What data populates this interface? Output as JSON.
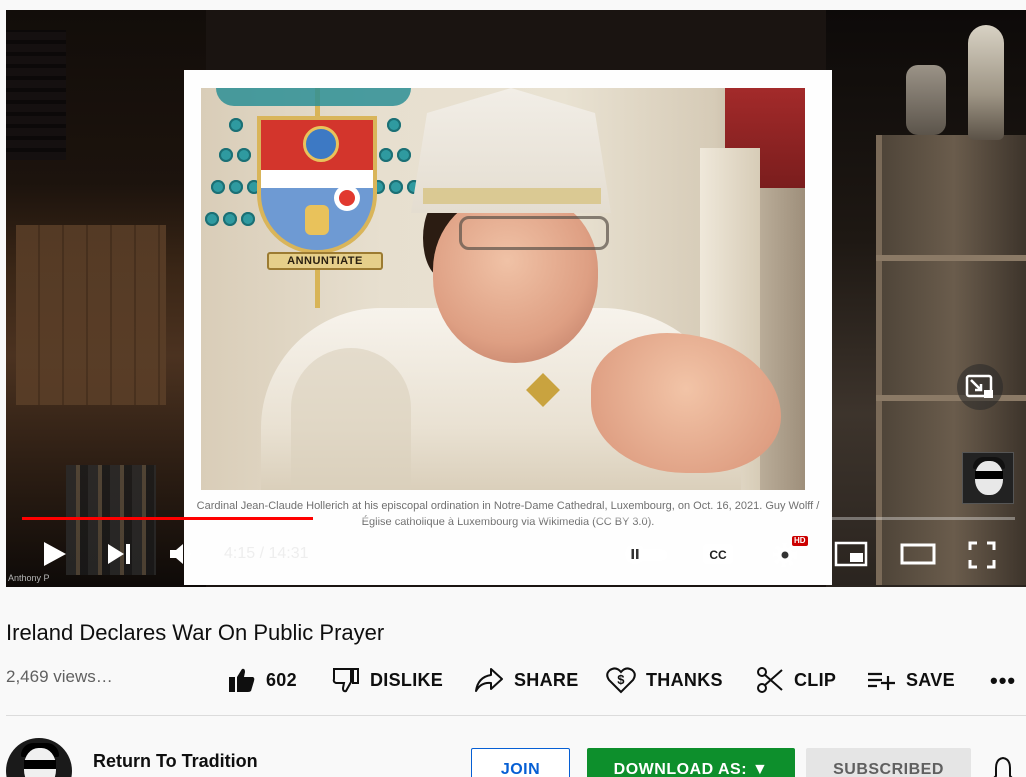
{
  "video": {
    "caption": "Cardinal Jean-Claude Hollerich at his episcopal ordination in Notre-Dame Cathedral, Luxembourg, on Oct. 16, 2021. Guy Wolff / Église catholique à Luxembourg via Wikimedia (CC BY 3.0).",
    "arms_motto": "ANNUNTIATE",
    "credit": "Anthony P",
    "current_time": "4:15",
    "duration": "14:31",
    "time_display": "4:15 / 14:31",
    "progress_fraction": 0.293,
    "hd_badge": "HD",
    "cc_label": "CC"
  },
  "meta": {
    "title": "Ireland Declares War On Public Prayer",
    "views": "2,469 views…"
  },
  "actions": {
    "like_count": "602",
    "dislike_label": "DISLIKE",
    "share_label": "SHARE",
    "thanks_label": "THANKS",
    "clip_label": "CLIP",
    "save_label": "SAVE",
    "more_label": "•••"
  },
  "channel": {
    "name": "Return To Tradition",
    "join_label": "JOIN",
    "download_label": "DOWNLOAD AS: ▼",
    "subscribed_label": "SUBSCRIBED"
  },
  "colors": {
    "progress": "#ff0000",
    "download_button": "#0d8f2c",
    "join_text": "#065fd4"
  }
}
